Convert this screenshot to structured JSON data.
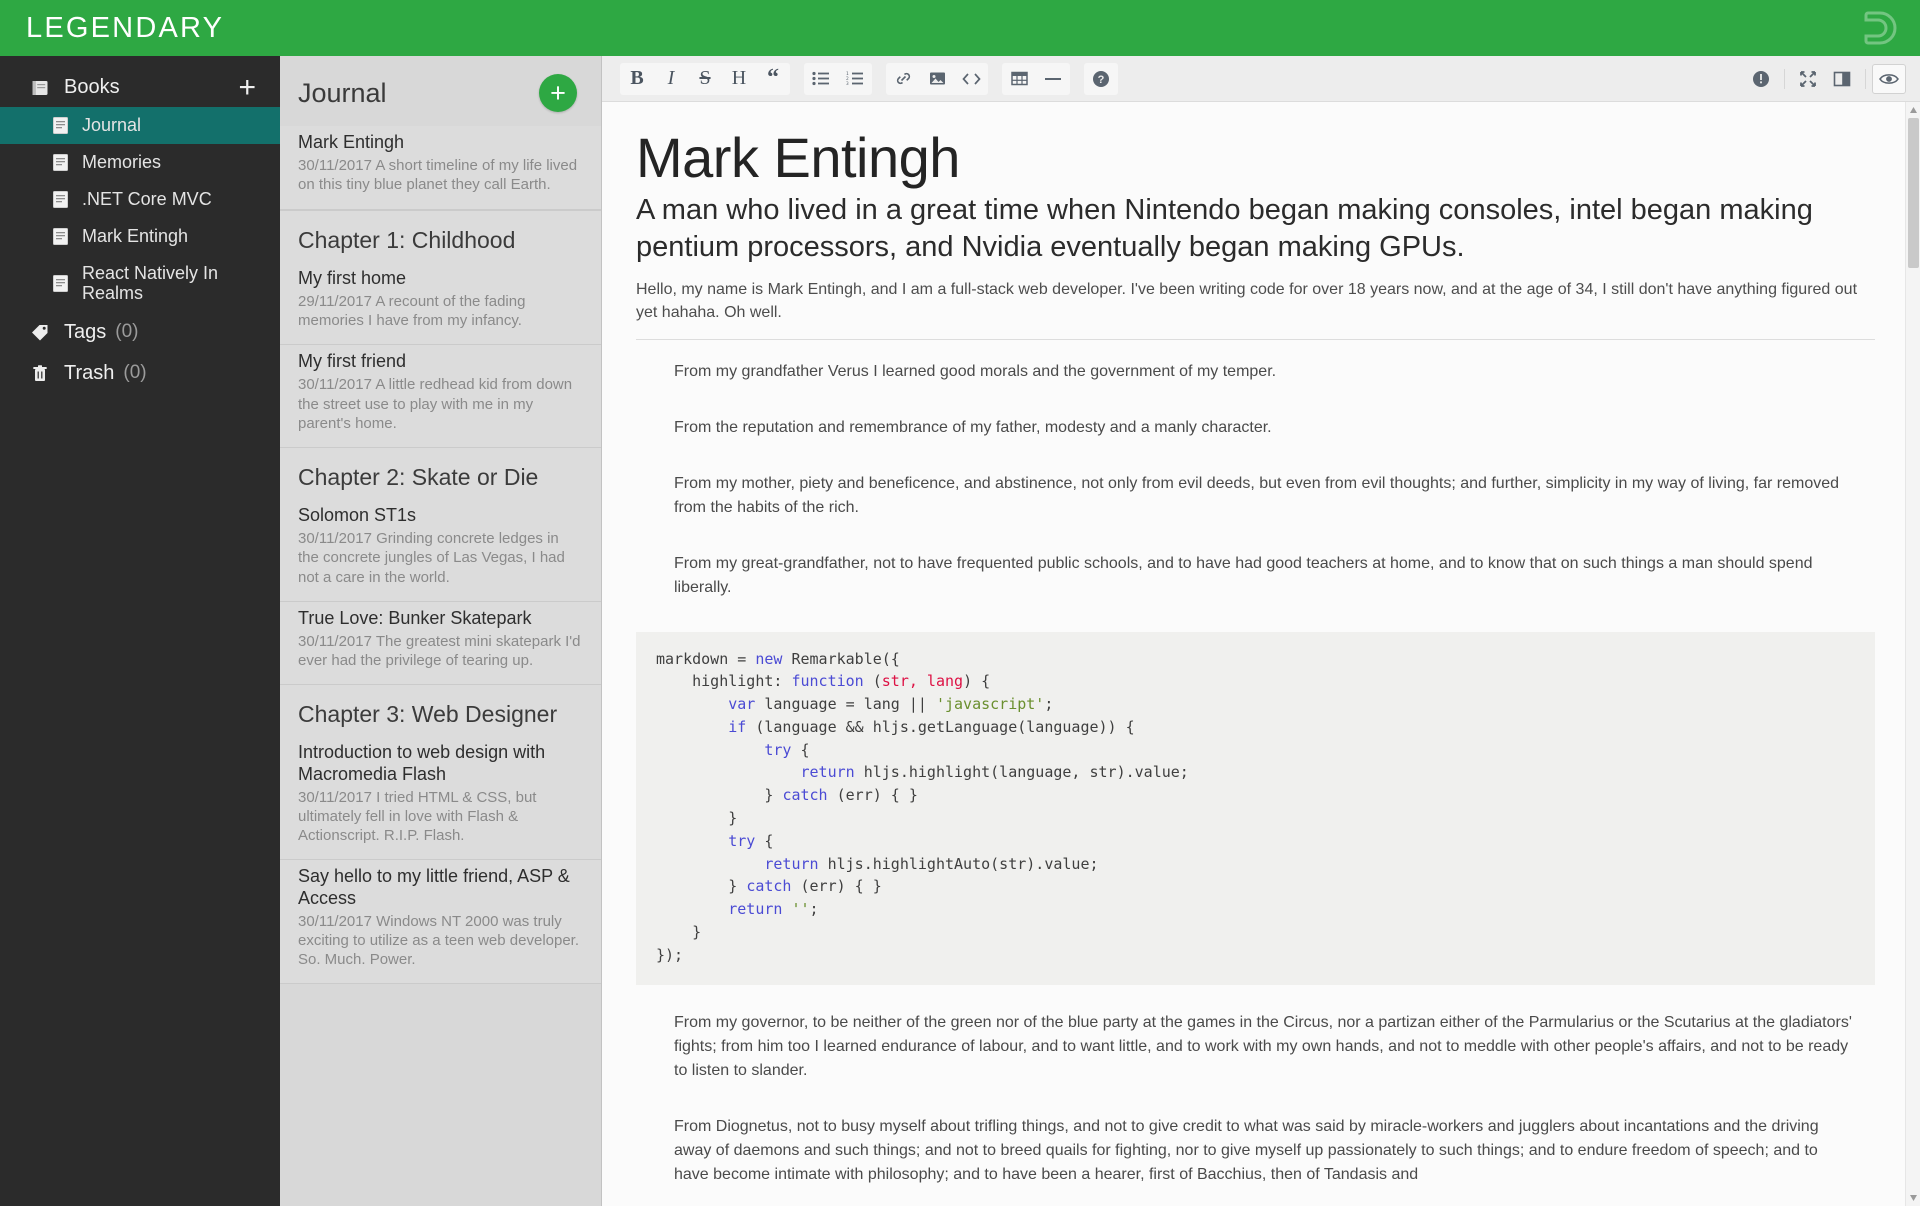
{
  "app": {
    "brand": "LEGENDARY",
    "logo_icon": "logo-mark-icon"
  },
  "sidebar": {
    "books_header": {
      "label": "Books",
      "icon": "book-icon",
      "add_icon": "plus-icon",
      "add_label": "+"
    },
    "books": [
      {
        "label": "Journal",
        "icon": "note-icon",
        "active": true
      },
      {
        "label": "Memories",
        "icon": "note-icon",
        "active": false
      },
      {
        "label": ".NET Core MVC",
        "icon": "note-icon",
        "active": false
      },
      {
        "label": "Mark Entingh",
        "icon": "note-icon",
        "active": false
      },
      {
        "label": "React Natively In Realms",
        "icon": "note-icon",
        "active": false
      }
    ],
    "tags": {
      "label": "Tags",
      "count": "(0)",
      "icon": "tag-icon"
    },
    "trash": {
      "label": "Trash",
      "count": "(0)",
      "icon": "trash-icon"
    }
  },
  "notelist": {
    "title": "Journal",
    "add_button_label": "+",
    "groups": [
      {
        "chapter": null,
        "notes": [
          {
            "title": "Mark Entingh",
            "date": "30/11/2017",
            "snippet": "A short timeline of my life lived on this tiny blue planet they call Earth."
          }
        ]
      },
      {
        "chapter": "Chapter 1: Childhood",
        "notes": [
          {
            "title": "My first home",
            "date": "29/11/2017",
            "snippet": "A recount of the fading memories I have from my infancy."
          },
          {
            "title": "My first friend",
            "date": "30/11/2017",
            "snippet": "A little redhead kid from down the street use to play with me in my parent's home."
          }
        ]
      },
      {
        "chapter": "Chapter 2: Skate or Die",
        "notes": [
          {
            "title": "Solomon ST1s",
            "date": "30/11/2017",
            "snippet": "Grinding concrete ledges in the concrete jungles of Las Vegas, I had not a care in the world."
          },
          {
            "title": "True Love: Bunker Skatepark",
            "date": "30/11/2017",
            "snippet": "The greatest mini skatepark I'd ever had the privilege of tearing up."
          }
        ]
      },
      {
        "chapter": "Chapter 3: Web Designer",
        "notes": [
          {
            "title": "Introduction to web design with Macromedia Flash",
            "date": "30/11/2017",
            "snippet": "I tried HTML & CSS, but ultimately fell in love with Flash & Actionscript. R.I.P. Flash."
          },
          {
            "title": "Say hello to my little friend, ASP & Access",
            "date": "30/11/2017",
            "snippet": "Windows NT 2000 was truly exciting to utilize as a teen web developer. So. Much. Power."
          }
        ]
      }
    ]
  },
  "toolbar": {
    "groups": [
      {
        "buttons": [
          {
            "name": "bold-button",
            "label": "B",
            "style": "bold"
          },
          {
            "name": "italic-button",
            "label": "I",
            "style": "ital"
          },
          {
            "name": "strike-button",
            "label": "S",
            "style": "strike"
          },
          {
            "name": "heading-button",
            "label": "H",
            "style": "plain"
          },
          {
            "name": "quote-button",
            "label": "“",
            "style": "quote"
          }
        ]
      },
      {
        "buttons": [
          {
            "name": "bullet-list-button",
            "label": "list-ul-icon",
            "style": "icon"
          },
          {
            "name": "numbered-list-button",
            "label": "list-ol-icon",
            "style": "icon"
          }
        ]
      },
      {
        "buttons": [
          {
            "name": "link-button",
            "label": "link-icon",
            "style": "icon"
          },
          {
            "name": "image-button",
            "label": "image-icon",
            "style": "icon"
          },
          {
            "name": "code-button",
            "label": "code-icon",
            "style": "icon"
          }
        ]
      },
      {
        "buttons": [
          {
            "name": "table-button",
            "label": "table-icon",
            "style": "icon"
          },
          {
            "name": "rule-button",
            "label": "minus-icon",
            "style": "icon"
          }
        ]
      },
      {
        "buttons": [
          {
            "name": "help-button",
            "label": "help-circle-icon",
            "style": "icon"
          }
        ]
      }
    ],
    "right_buttons": [
      {
        "name": "info-button",
        "label": "info-circle-icon",
        "active": false
      },
      {
        "name": "fullscreen-button",
        "label": "expand-arrows-icon",
        "active": false
      },
      {
        "name": "split-view-button",
        "label": "columns-icon",
        "active": false
      },
      {
        "name": "preview-button",
        "label": "eye-icon",
        "active": true
      }
    ]
  },
  "document": {
    "title": "Mark Entingh",
    "subtitle": "A man who lived in a great time when Nintendo began making consoles, intel began making pentium processors, and Nvidia eventually began making GPUs.",
    "lede": "Hello, my name is Mark Entingh, and I am a full-stack web developer. I've been writing code for over 18 years now, and at the age of 34, I still don't have anything figured out yet hahaha. Oh well.",
    "paragraphs": [
      "From my grandfather Verus I learned good morals and the government of my temper.",
      "From the reputation and remembrance of my father, modesty and a manly character.",
      "From my mother, piety and beneficence, and abstinence, not only from evil deeds, but even from evil thoughts; and further, simplicity in my way of living, far removed from the habits of the rich.",
      "From my great-grandfather, not to have frequented public schools, and to have had good teachers at home, and to know that on such things a man should spend liberally."
    ],
    "paragraphs_after": [
      "From my governor, to be neither of the green nor of the blue party at the games in the Circus, nor a partizan either of the Parmularius or the Scutarius at the gladiators' fights; from him too I learned endurance of labour, and to want little, and to work with my own hands, and not to meddle with other people's affairs, and not to be ready to listen to slander.",
      "From Diognetus, not to busy myself about trifling things, and not to give credit to what was said by miracle-workers and jugglers about incantations and the driving away of daemons and such things; and not to breed quails for fighting, nor to give myself up passionately to such things; and to endure freedom of speech; and to have become intimate with philosophy; and to have been a hearer, first of Bacchius, then of Tandasis and"
    ],
    "code_lines": [
      [
        {
          "t": "markdown = ",
          "c": ""
        },
        {
          "t": "new",
          "c": "k"
        },
        {
          "t": " Remarkable({",
          "c": ""
        }
      ],
      [
        {
          "t": "    highlight: ",
          "c": ""
        },
        {
          "t": "function",
          "c": "k"
        },
        {
          "t": " (",
          "c": ""
        },
        {
          "t": "str, lang",
          "c": "p"
        },
        {
          "t": ") {",
          "c": ""
        }
      ],
      [
        {
          "t": "        ",
          "c": ""
        },
        {
          "t": "var",
          "c": "k"
        },
        {
          "t": " language = lang || ",
          "c": ""
        },
        {
          "t": "'javascript'",
          "c": "s"
        },
        {
          "t": ";",
          "c": ""
        }
      ],
      [
        {
          "t": "        ",
          "c": ""
        },
        {
          "t": "if",
          "c": "k"
        },
        {
          "t": " (language && hljs.getLanguage(language)) {",
          "c": ""
        }
      ],
      [
        {
          "t": "            ",
          "c": ""
        },
        {
          "t": "try",
          "c": "k"
        },
        {
          "t": " {",
          "c": ""
        }
      ],
      [
        {
          "t": "                ",
          "c": ""
        },
        {
          "t": "return",
          "c": "k"
        },
        {
          "t": " hljs.highlight(language, str).value;",
          "c": ""
        }
      ],
      [
        {
          "t": "            } ",
          "c": ""
        },
        {
          "t": "catch",
          "c": "k"
        },
        {
          "t": " (err) { }",
          "c": ""
        }
      ],
      [
        {
          "t": "        }",
          "c": ""
        }
      ],
      [
        {
          "t": "        ",
          "c": ""
        },
        {
          "t": "try",
          "c": "k"
        },
        {
          "t": " {",
          "c": ""
        }
      ],
      [
        {
          "t": "            ",
          "c": ""
        },
        {
          "t": "return",
          "c": "k"
        },
        {
          "t": " hljs.highlightAuto(str).value;",
          "c": ""
        }
      ],
      [
        {
          "t": "        } ",
          "c": ""
        },
        {
          "t": "catch",
          "c": "k"
        },
        {
          "t": " (err) { }",
          "c": ""
        }
      ],
      [
        {
          "t": "        ",
          "c": ""
        },
        {
          "t": "return",
          "c": "k"
        },
        {
          "t": " ",
          "c": ""
        },
        {
          "t": "''",
          "c": "s"
        },
        {
          "t": ";",
          "c": ""
        }
      ],
      [
        {
          "t": "    }",
          "c": ""
        }
      ],
      [
        {
          "t": "});",
          "c": ""
        }
      ]
    ]
  },
  "colors": {
    "brand_green": "#2ea843",
    "sidebar_dark": "#2b2b2b",
    "active_teal": "#13706b",
    "list_gray": "#dcdcdc"
  }
}
